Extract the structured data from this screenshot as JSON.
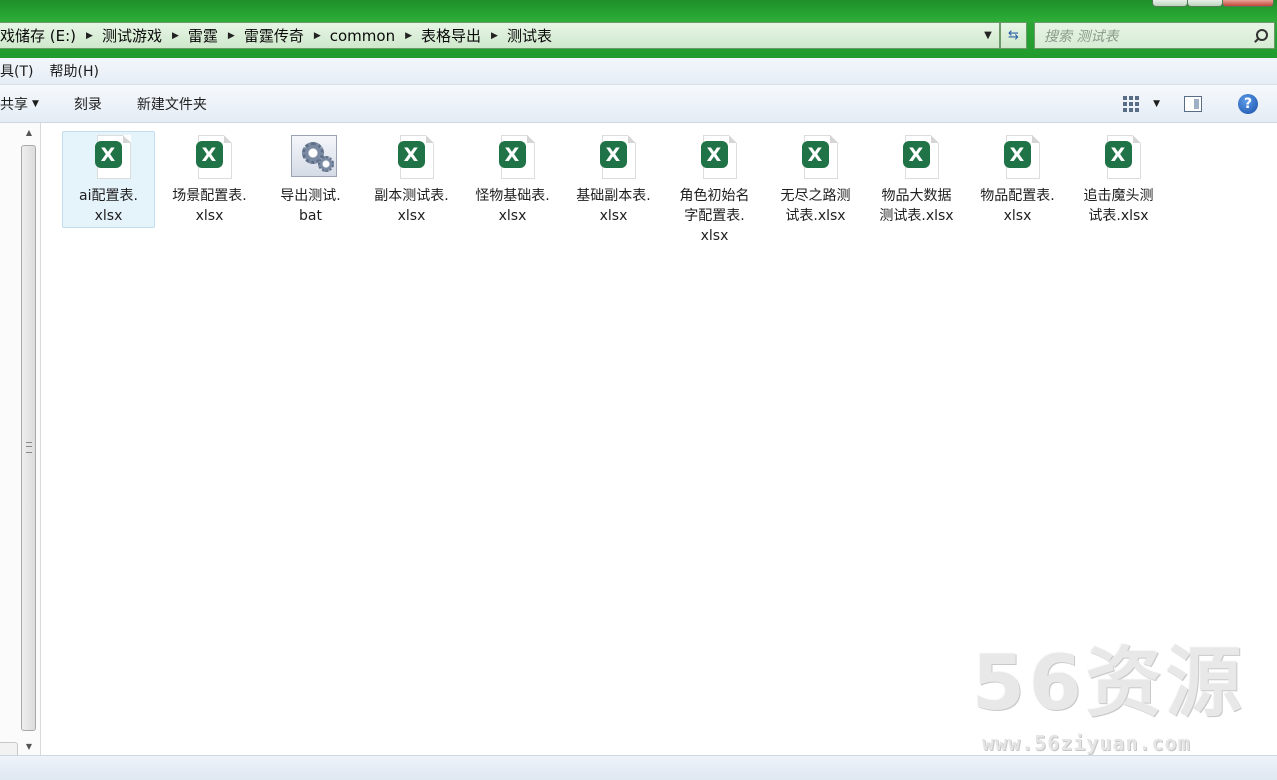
{
  "address": {
    "crumbs": [
      "戏储存 (E:)",
      "测试游戏",
      "雷霆",
      "雷霆传奇",
      "common",
      "表格导出",
      "测试表"
    ]
  },
  "search": {
    "placeholder": "搜索 测试表"
  },
  "menu": [
    "具(T)",
    "帮助(H)"
  ],
  "toolbar": {
    "share": "共享",
    "burn": "刻录",
    "new_folder": "新建文件夹"
  },
  "files": [
    {
      "name": "ai配置表.xlsx",
      "type": "xlsx",
      "selected": true,
      "lines": [
        "ai配置表.",
        "xlsx"
      ]
    },
    {
      "name": "场景配置表.xlsx",
      "type": "xlsx",
      "lines": [
        "场景配置表.",
        "xlsx"
      ]
    },
    {
      "name": "导出测试.bat",
      "type": "bat",
      "lines": [
        "导出测试.",
        "bat"
      ]
    },
    {
      "name": "副本测试表.xlsx",
      "type": "xlsx",
      "lines": [
        "副本测试表.",
        "xlsx"
      ]
    },
    {
      "name": "怪物基础表.xlsx",
      "type": "xlsx",
      "lines": [
        "怪物基础表.",
        "xlsx"
      ]
    },
    {
      "name": "基础副本表.xlsx",
      "type": "xlsx",
      "lines": [
        "基础副本表.",
        "xlsx"
      ]
    },
    {
      "name": "角色初始名字配置表.xlsx",
      "type": "xlsx",
      "lines": [
        "角色初始名",
        "字配置表.",
        "xlsx"
      ]
    },
    {
      "name": "无尽之路测试表.xlsx",
      "type": "xlsx",
      "lines": [
        "无尽之路测",
        "试表.xlsx"
      ]
    },
    {
      "name": "物品大数据测试表.xlsx",
      "type": "xlsx",
      "lines": [
        "物品大数据",
        "测试表.xlsx"
      ]
    },
    {
      "name": "物品配置表.xlsx",
      "type": "xlsx",
      "lines": [
        "物品配置表.",
        "xlsx"
      ]
    },
    {
      "name": "追击魔头测试表.xlsx",
      "type": "xlsx",
      "lines": [
        "追击魔头测",
        "试表.xlsx"
      ]
    }
  ],
  "watermark": {
    "brand": "56资源",
    "url": "www.56ziyuan.com"
  },
  "icons": {
    "xlsx": "excel-file-icon",
    "bat": "batch-file-gear-icon",
    "search": "magnifier-icon",
    "refresh": "refresh-arrows-icon",
    "help": "help-question-icon"
  }
}
